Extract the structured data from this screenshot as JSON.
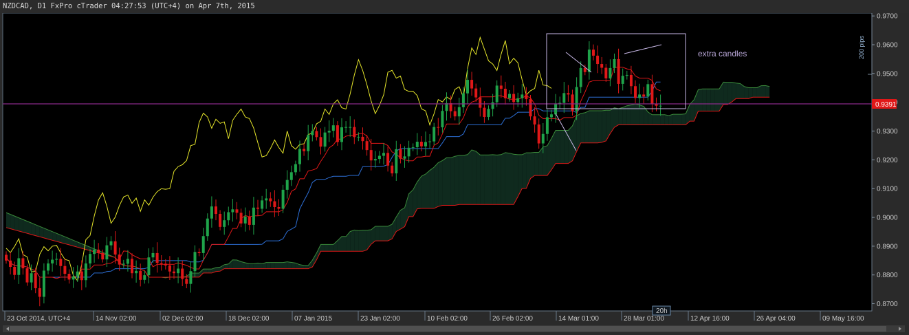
{
  "window": {
    "title": "NZDCAD, D1 FxPro cTrader 04:27:53 (UTC+4) on Apr 7th, 2015"
  },
  "current_price_label": "0.9391",
  "timeframe_badge": "20h",
  "pips_label": "200 pips",
  "annotation": "extra candles",
  "colors": {
    "bull": "#1fa34a",
    "bear": "#e01818",
    "tenkan": "#e01818",
    "kijun": "#2d6fd6",
    "chikou": "#e6e62a",
    "span_b": "#e01818",
    "span_a": "#3a8a3a",
    "cloud_bull": "#0f2a1e",
    "cloud_bear": "#3a0808",
    "price_line": "#7a1f6a"
  },
  "chart_data": {
    "type": "candlestick",
    "title": "NZDCAD, D1",
    "ylim": [
      0.8675,
      0.971
    ],
    "y_ticks": [
      "0.9700",
      "0.9600",
      "0.9500",
      "0.9400",
      "0.9300",
      "0.9200",
      "0.9100",
      "0.9000",
      "0.8900",
      "0.8800",
      "0.8700"
    ],
    "x_tick_labels": [
      "23 Oct 2014, UTC+4",
      "14 Nov 02:00",
      "02 Dec 02:00",
      "18 Dec 02:00",
      "07 Jan 2015",
      "23 Jan 02:00",
      "10 Feb 02:00",
      "26 Feb 02:00",
      "14 Mar 01:00",
      "28 Mar 01:00",
      "12 Apr 16:00",
      "26 Apr 04:00",
      "09 May 16:00"
    ],
    "current_price": 0.9391,
    "candles_close": [
      0.885,
      0.8828,
      0.88,
      0.8858,
      0.8823,
      0.8774,
      0.8806,
      0.8754,
      0.8724,
      0.8815,
      0.884,
      0.8853,
      0.8856,
      0.8831,
      0.8804,
      0.8784,
      0.8795,
      0.8812,
      0.8782,
      0.884,
      0.8873,
      0.8888,
      0.8876,
      0.8854,
      0.8903,
      0.8917,
      0.8871,
      0.8836,
      0.8839,
      0.8856,
      0.8806,
      0.8814,
      0.8783,
      0.8799,
      0.8861,
      0.8876,
      0.8842,
      0.8839,
      0.8833,
      0.8812,
      0.8806,
      0.8822,
      0.8786,
      0.8769,
      0.8813,
      0.888,
      0.8876,
      0.8935,
      0.8996,
      0.9038,
      0.9012,
      0.8967,
      0.899,
      0.9018,
      0.9028,
      0.9016,
      0.8979,
      0.9003,
      0.8974,
      0.9034,
      0.903,
      0.9059,
      0.9066,
      0.9056,
      0.9036,
      0.903,
      0.9096,
      0.913,
      0.9157,
      0.9185,
      0.9238,
      0.923,
      0.9286,
      0.93,
      0.9279,
      0.9246,
      0.9295,
      0.9301,
      0.932,
      0.9262,
      0.9313,
      0.9314,
      0.9314,
      0.9279,
      0.928,
      0.9265,
      0.9234,
      0.9198,
      0.9203,
      0.9214,
      0.9224,
      0.918,
      0.9153,
      0.9237,
      0.9204,
      0.9212,
      0.9242,
      0.9244,
      0.9263,
      0.9247,
      0.9262,
      0.9264,
      0.9314,
      0.9313,
      0.937,
      0.9397,
      0.9369,
      0.9351,
      0.9383,
      0.9431,
      0.9478,
      0.9448,
      0.9417,
      0.9381,
      0.9349,
      0.9377,
      0.94,
      0.9458,
      0.9447,
      0.9414,
      0.9429,
      0.9401,
      0.9414,
      0.9427,
      0.9411,
      0.9351,
      0.9323,
      0.9257,
      0.929,
      0.9348,
      0.9358,
      0.9396,
      0.9398,
      0.9432,
      0.9427,
      0.9369,
      0.9453,
      0.9519,
      0.9505,
      0.9583,
      0.9562,
      0.9533,
      0.952,
      0.9483,
      0.9519,
      0.955,
      0.9464,
      0.9492,
      0.9495,
      0.9456,
      0.9415,
      0.9427,
      0.942,
      0.9463,
      0.9395,
      0.9388,
      0.9388
    ]
  }
}
